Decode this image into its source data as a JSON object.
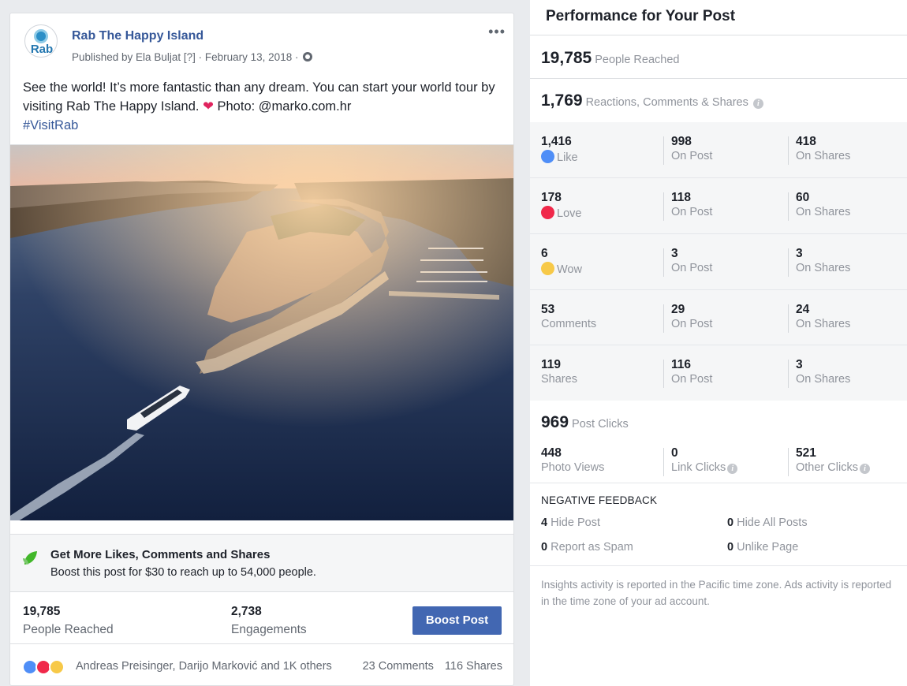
{
  "post": {
    "page_name": "Rab The Happy Island",
    "avatar_text": "Rab",
    "published_prefix": "Published by Ela Buljat",
    "help_marker": "[?]",
    "date": "· February 13, 2018 ·",
    "more_label": "•••",
    "text": "See the world! It’s more fantastic than any dream. You can start your world tour by visiting Rab The Happy Island.",
    "heart": "❤",
    "photo_credit": "Photo: @marko.com.hr",
    "hashtag": "#VisitRab"
  },
  "promo": {
    "title": "Get More Likes, Comments and Shares",
    "subtitle": "Boost this post for $30 to reach up to 54,000 people."
  },
  "post_stats": {
    "reached_value": "19,785",
    "reached_label": "People Reached",
    "engagements_value": "2,738",
    "engagements_label": "Engagements",
    "boost_button": "Boost Post"
  },
  "reactions_bar": {
    "names": "Andreas Preisinger, Darijo Marković and 1K others",
    "comments": "23 Comments",
    "shares": "116 Shares"
  },
  "insights": {
    "title": "Performance for Your Post",
    "people_reached_value": "19,785",
    "people_reached_label": "People Reached",
    "engagement_value": "1,769",
    "engagement_label": "Reactions, Comments & Shares",
    "rows": [
      {
        "total": "1,416",
        "label": "Like",
        "post": "998",
        "post_label": "On Post",
        "shares": "418",
        "shares_label": "On Shares"
      },
      {
        "total": "178",
        "label": "Love",
        "post": "118",
        "post_label": "On Post",
        "shares": "60",
        "shares_label": "On Shares"
      },
      {
        "total": "6",
        "label": "Wow",
        "post": "3",
        "post_label": "On Post",
        "shares": "3",
        "shares_label": "On Shares"
      },
      {
        "total": "53",
        "label": "Comments",
        "post": "29",
        "post_label": "On Post",
        "shares": "24",
        "shares_label": "On Shares"
      },
      {
        "total": "119",
        "label": "Shares",
        "post": "116",
        "post_label": "On Post",
        "shares": "3",
        "shares_label": "On Shares"
      }
    ],
    "post_clicks_value": "969",
    "post_clicks_label": "Post Clicks",
    "clicks": [
      {
        "value": "448",
        "label": "Photo Views"
      },
      {
        "value": "0",
        "label": "Link Clicks"
      },
      {
        "value": "521",
        "label": "Other Clicks"
      }
    ],
    "negative_title": "NEGATIVE FEEDBACK",
    "negative": [
      {
        "value": "4",
        "label": "Hide Post"
      },
      {
        "value": "0",
        "label": "Hide All Posts"
      },
      {
        "value": "0",
        "label": "Report as Spam"
      },
      {
        "value": "0",
        "label": "Unlike Page"
      }
    ],
    "footnote": "Insights activity is reported in the Pacific time zone. Ads activity is reported in the time zone of your ad account.",
    "info_icon": "i"
  },
  "colors": {
    "link_blue": "#365899",
    "button_blue": "#4267b2",
    "like_blue": "#4f8ef7",
    "love_red": "#f0284a",
    "wow_yellow": "#f7c948"
  },
  "icons": [
    "avatar-logo",
    "globe-icon",
    "more-options-icon",
    "heart-emoji-icon",
    "leaf-icon",
    "like-icon",
    "love-icon",
    "wow-icon",
    "info-icon"
  ]
}
